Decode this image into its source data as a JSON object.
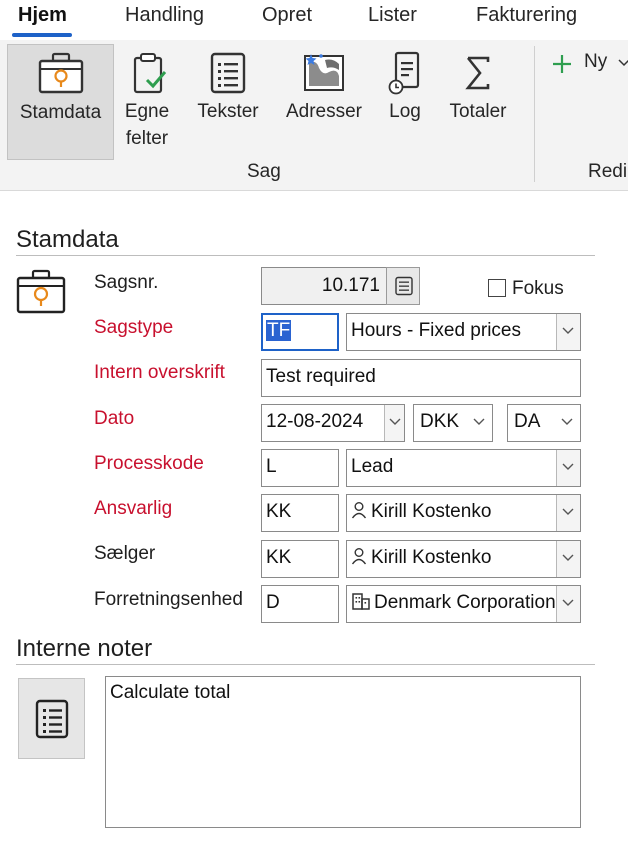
{
  "tabs": {
    "hjem": "Hjem",
    "handling": "Handling",
    "opret": "Opret",
    "lister": "Lister",
    "fakturering": "Fakturering"
  },
  "ribbon": {
    "stamdata": "Stamdata",
    "egne_line1": "Egne",
    "egne_line2": "felter",
    "tekster": "Tekster",
    "adresser": "Adresser",
    "log": "Log",
    "totaler": "Totaler",
    "ny": "Ny",
    "group_sag": "Sag",
    "group_redi": "Redi"
  },
  "stamdata": {
    "title": "Stamdata",
    "sagsnr_label": "Sagsnr.",
    "sagsnr_value": "10.171",
    "fokus_label": "Fokus",
    "sagstype_label": "Sagstype",
    "sagstype_code": "TF",
    "sagstype_value": "Hours - Fixed prices",
    "intern_label": "Intern overskrift",
    "intern_value": "Test required",
    "dato_label": "Dato",
    "dato_value": "12-08-2024",
    "currency_value": "DKK",
    "language_value": "DA",
    "processkode_label": "Processkode",
    "processkode_code": "L",
    "processkode_value": "Lead",
    "ansvarlig_label": "Ansvarlig",
    "ansvarlig_code": "KK",
    "ansvarlig_value": "Kirill Kostenko",
    "saelger_label": "Sælger",
    "saelger_code": "KK",
    "saelger_value": "Kirill Kostenko",
    "forretning_label": "Forretningsenhed",
    "forretning_code": "D",
    "forretning_value": "Denmark Corporation"
  },
  "notes": {
    "title": "Interne noter",
    "text": "Calculate total"
  },
  "colors": {
    "accent": "#1e62c8",
    "required_label": "#c8102e",
    "selection": "#2a63d1",
    "icon_orange": "#e8891b",
    "icon_green": "#2e9e4f"
  }
}
